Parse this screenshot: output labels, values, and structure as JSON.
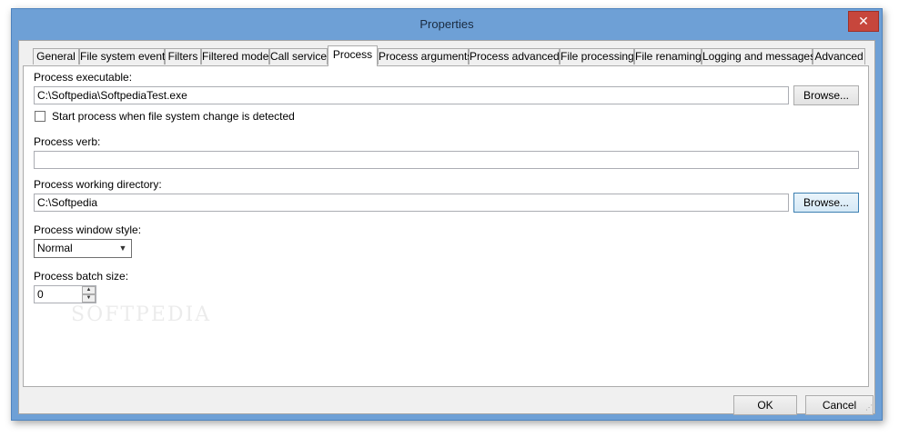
{
  "window": {
    "title": "Properties",
    "close_glyph": "✕"
  },
  "tabs": [
    {
      "label": "General"
    },
    {
      "label": "File system events"
    },
    {
      "label": "Filters"
    },
    {
      "label": "Filtered mode"
    },
    {
      "label": "Call service"
    },
    {
      "label": "Process"
    },
    {
      "label": "Process arguments"
    },
    {
      "label": "Process advanced"
    },
    {
      "label": "File processing"
    },
    {
      "label": "File renaming"
    },
    {
      "label": "Logging and messages"
    },
    {
      "label": "Advanced"
    }
  ],
  "active_tab": "Process",
  "form": {
    "executable_label": "Process executable:",
    "executable_value": "C:\\Softpedia\\SoftpediaTest.exe",
    "browse_label": "Browse...",
    "start_on_change_label": "Start process when file system change is detected",
    "start_on_change_checked": false,
    "verb_label": "Process verb:",
    "verb_value": "",
    "workdir_label": "Process working directory:",
    "workdir_value": "C:\\Softpedia",
    "window_style_label": "Process window style:",
    "window_style_value": "Normal",
    "batch_size_label": "Process batch size:",
    "batch_size_value": "0"
  },
  "buttons": {
    "ok": "OK",
    "cancel": "Cancel"
  },
  "icons": {
    "dropdown": "chevron-down-icon",
    "spin_up": "arrow-up-icon",
    "spin_down": "arrow-down-icon"
  },
  "colors": {
    "titlebar": "#6ea0d6",
    "close": "#c7463c",
    "client": "#f0f0f0"
  }
}
